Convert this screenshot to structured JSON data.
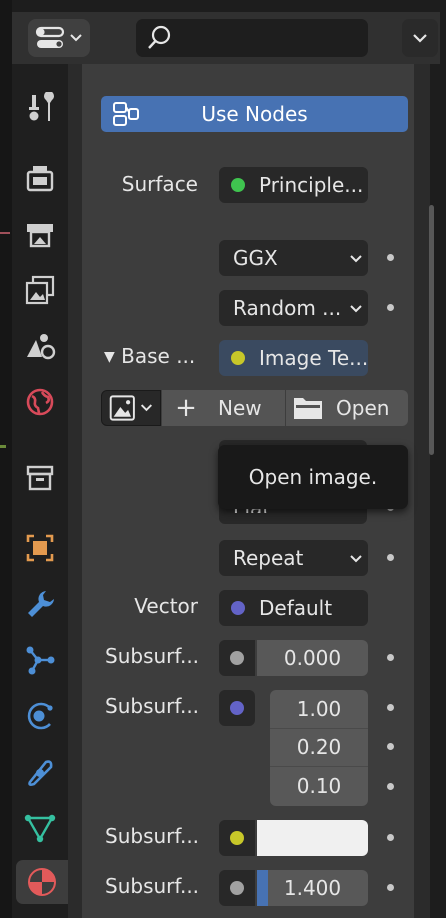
{
  "colors": {
    "accent": "#4772b3",
    "socket_green": "#3fc44f",
    "socket_yellow": "#c7c729",
    "socket_purple": "#6363c7",
    "socket_gray": "#a1a1a1",
    "active_tab": "#e25a5a"
  },
  "header": {
    "editor_type_icon": "properties-editor-icon",
    "search_icon": "search-icon",
    "search_placeholder": ""
  },
  "tabs": [
    {
      "icon": "tool-icon",
      "active": false
    },
    {
      "icon": "render-icon",
      "active": false
    },
    {
      "icon": "output-icon",
      "active": false
    },
    {
      "icon": "view-layer-icon",
      "active": false
    },
    {
      "icon": "scene-icon",
      "active": false
    },
    {
      "icon": "world-icon",
      "active": false
    },
    {
      "icon": "collection-icon",
      "active": false
    },
    {
      "icon": "object-icon",
      "active": false
    },
    {
      "icon": "modifier-icon",
      "active": false
    },
    {
      "icon": "particles-icon",
      "active": false
    },
    {
      "icon": "physics-icon",
      "active": false
    },
    {
      "icon": "constraints-icon",
      "active": false
    },
    {
      "icon": "data-icon",
      "active": false
    },
    {
      "icon": "material-icon",
      "active": true
    }
  ],
  "material": {
    "use_nodes_label": "Use Nodes",
    "surface_label": "Surface",
    "surface_value": "Principle...",
    "distribution_value": "GGX",
    "subsurface_method_value": "Random ...",
    "base_color_label": "Base ...",
    "base_color_value": "Image Te...",
    "new_label": "New",
    "open_label": "Open",
    "tooltip_text": "Open image.",
    "interpolation_value": "Flat",
    "extension_value": "Repeat",
    "vector_label": "Vector",
    "vector_value": "Default",
    "subsurface_label": "Subsurf...",
    "subsurface_value": "0.000",
    "subsurface_radius_label": "Subsurf...",
    "subsurface_radius_values": [
      "1.00",
      "0.20",
      "0.10"
    ],
    "subsurface_color_label": "Subsurf...",
    "subsurface_ior_label": "Subsurf...",
    "subsurface_ior_value": "1.400"
  }
}
